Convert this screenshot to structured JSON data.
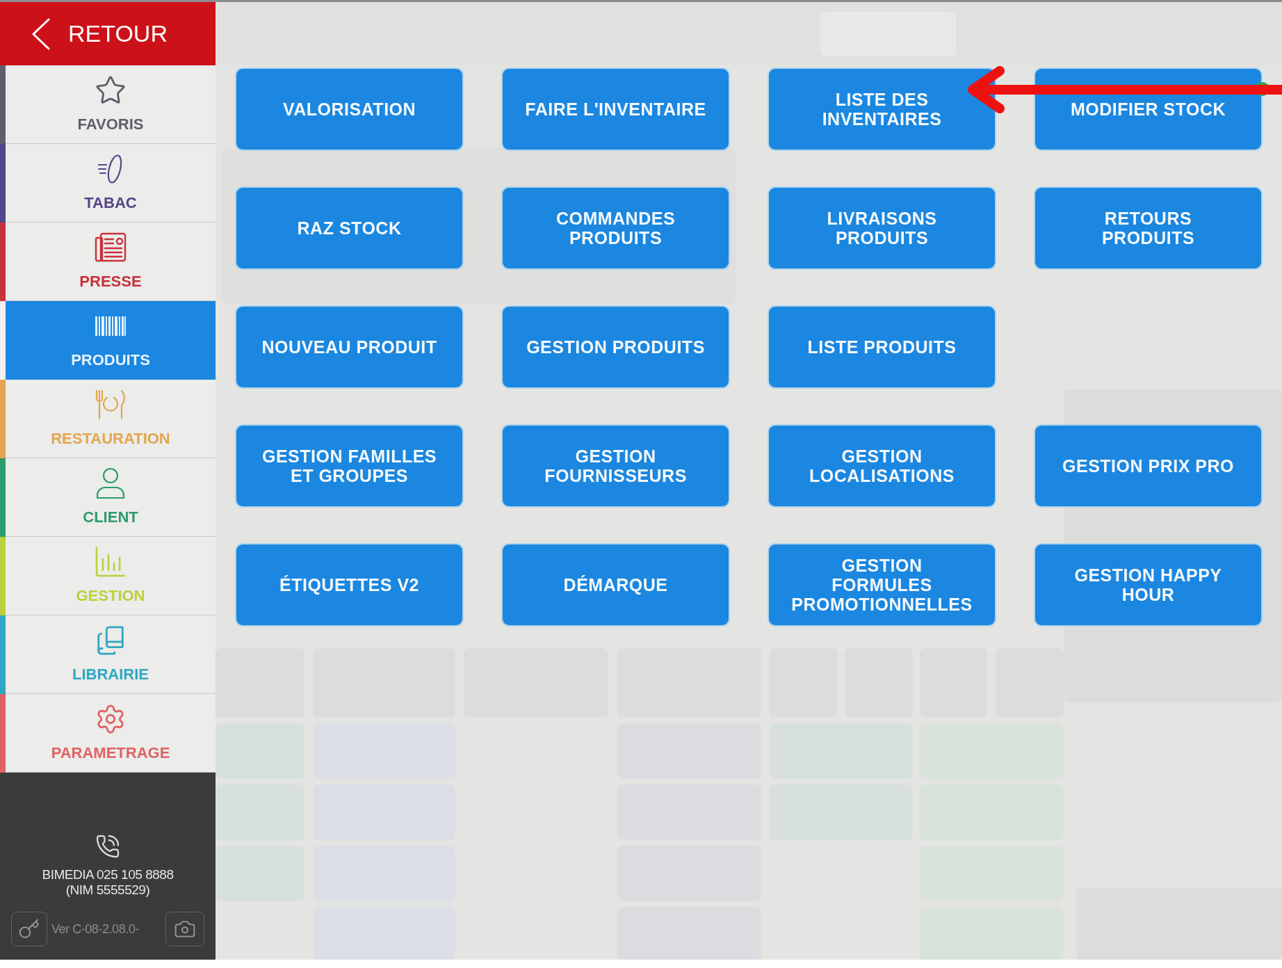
{
  "sidebar": {
    "back_button": {
      "label": "RETOUR"
    },
    "items": [
      {
        "label": "FAVORIS",
        "kind": "star",
        "color": "#5d5f6e",
        "selected": false
      },
      {
        "label": "TABAC",
        "kind": "leaf",
        "color": "#55458a",
        "selected": false
      },
      {
        "label": "PRESSE",
        "kind": "newspaper",
        "color": "#c7323b",
        "selected": false
      },
      {
        "label": "PRODUITS",
        "kind": "barcode",
        "color": "#1b87e0",
        "selected": true
      },
      {
        "label": "RESTAURATION",
        "kind": "utensils",
        "color": "#e2a550",
        "selected": false
      },
      {
        "label": "CLIENT",
        "kind": "user",
        "color": "#2b9c6d",
        "selected": false
      },
      {
        "label": "GESTION",
        "kind": "chart",
        "color": "#bcd03a",
        "selected": false
      },
      {
        "label": "LIBRAIRIE",
        "kind": "books",
        "color": "#2ea8c2",
        "selected": false
      },
      {
        "label": "PARAMETRAGE",
        "kind": "gear",
        "color": "#de6363",
        "selected": false
      }
    ],
    "footer": {
      "contact": "BIMEDIA 025 105 8888\n(NIM 5555529)",
      "version": "Ver C-08-2.08.0-"
    }
  },
  "menu": {
    "rows": [
      [
        "VALORISATION",
        "FAIRE L'INVENTAIRE",
        "LISTE DES\nINVENTAIRES",
        "MODIFIER STOCK"
      ],
      [
        "RAZ STOCK",
        "COMMANDES\nPRODUITS",
        "LIVRAISONS\nPRODUITS",
        "RETOURS\nPRODUITS"
      ],
      [
        "NOUVEAU PRODUIT",
        "GESTION PRODUITS",
        "LISTE PRODUITS"
      ],
      [
        "GESTION FAMILLES\nET GROUPES",
        "GESTION\nFOURNISSEURS",
        "GESTION\nLOCALISATIONS",
        "GESTION PRIX PRO"
      ],
      [
        "ÉTIQUETTES V2",
        "DÉMARQUE",
        "GESTION\nFORMULES\nPROMOTIONNELLES",
        "GESTION HAPPY\nHOUR"
      ]
    ]
  }
}
